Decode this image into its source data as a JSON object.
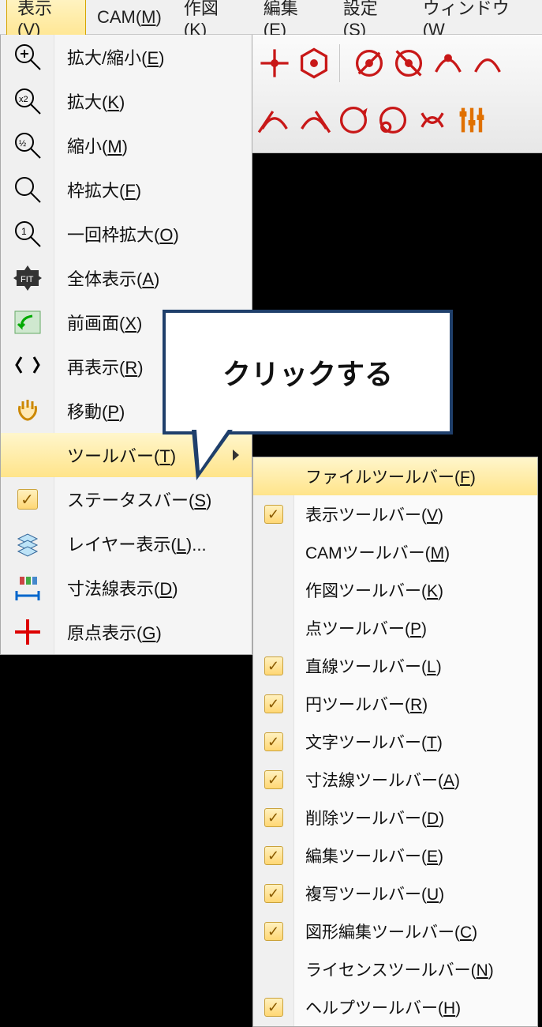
{
  "menubar": {
    "items": [
      {
        "label": "表示(",
        "mn": "V",
        "tail": ")",
        "active": true
      },
      {
        "label": "CAM(",
        "mn": "M",
        "tail": ")"
      },
      {
        "label": "作図(",
        "mn": "K",
        "tail": ")"
      },
      {
        "label": "編集(",
        "mn": "E",
        "tail": ")"
      },
      {
        "label": "設定(",
        "mn": "S",
        "tail": ")"
      },
      {
        "label": "ウィンドウ(",
        "mn": "W",
        "tail": ""
      }
    ]
  },
  "dropdown": {
    "items": [
      {
        "icon": "zoom-plus",
        "label": "拡大/縮小(",
        "mn": "E",
        "tail": ")"
      },
      {
        "icon": "zoom-x2",
        "label": "拡大(",
        "mn": "K",
        "tail": ")"
      },
      {
        "icon": "zoom-half",
        "label": "縮小(",
        "mn": "M",
        "tail": ")"
      },
      {
        "icon": "zoom-frame",
        "label": "枠拡大(",
        "mn": "F",
        "tail": ")"
      },
      {
        "icon": "zoom-once",
        "label": "一回枠拡大(",
        "mn": "O",
        "tail": ")"
      },
      {
        "icon": "fit",
        "label": "全体表示(",
        "mn": "A",
        "tail": ")"
      },
      {
        "icon": "prev",
        "label": "前画面(",
        "mn": "X",
        "tail": ")"
      },
      {
        "icon": "redisplay",
        "label": "再表示(",
        "mn": "R",
        "tail": ")"
      },
      {
        "icon": "pan",
        "label": "移動(",
        "mn": "P",
        "tail": ")"
      },
      {
        "icon": "",
        "label": "ツールバー(",
        "mn": "T",
        "tail": ")",
        "highlight": true,
        "submenu": true
      },
      {
        "icon": "check",
        "label": "ステータスバー(",
        "mn": "S",
        "tail": ")"
      },
      {
        "icon": "layers",
        "label": "レイヤー表示(",
        "mn": "L",
        "tail": ")..."
      },
      {
        "icon": "dim",
        "label": "寸法線表示(",
        "mn": "D",
        "tail": ")"
      },
      {
        "icon": "origin",
        "label": "原点表示(",
        "mn": "G",
        "tail": ")"
      }
    ]
  },
  "submenu": {
    "items": [
      {
        "checked": false,
        "label": "ファイルツールバー(",
        "mn": "F",
        "tail": ")",
        "highlight": true
      },
      {
        "checked": true,
        "label": "表示ツールバー(",
        "mn": "V",
        "tail": ")"
      },
      {
        "checked": false,
        "label": "CAMツールバー(",
        "mn": "M",
        "tail": ")"
      },
      {
        "checked": false,
        "label": "作図ツールバー(",
        "mn": "K",
        "tail": ")"
      },
      {
        "checked": false,
        "label": "点ツールバー(",
        "mn": "P",
        "tail": ")"
      },
      {
        "checked": true,
        "label": "直線ツールバー(",
        "mn": "L",
        "tail": ")"
      },
      {
        "checked": true,
        "label": "円ツールバー(",
        "mn": "R",
        "tail": ")"
      },
      {
        "checked": true,
        "label": "文字ツールバー(",
        "mn": "T",
        "tail": ")"
      },
      {
        "checked": true,
        "label": "寸法線ツールバー(",
        "mn": "A",
        "tail": ")"
      },
      {
        "checked": true,
        "label": "削除ツールバー(",
        "mn": "D",
        "tail": ")"
      },
      {
        "checked": true,
        "label": "編集ツールバー(",
        "mn": "E",
        "tail": ")"
      },
      {
        "checked": true,
        "label": "複写ツールバー(",
        "mn": "U",
        "tail": ")"
      },
      {
        "checked": true,
        "label": "図形編集ツールバー(",
        "mn": "C",
        "tail": ")"
      },
      {
        "checked": false,
        "label": "ライセンスツールバー(",
        "mn": "N",
        "tail": ")"
      },
      {
        "checked": true,
        "label": "ヘルプツールバー(",
        "mn": "H",
        "tail": ")"
      }
    ]
  },
  "callout": {
    "text": "クリックする"
  },
  "toolbar_icons_row1": [
    "cross-target",
    "hex-dot",
    "separator",
    "circle-diag",
    "circle-diag2",
    "arc-dot",
    "arc"
  ],
  "toolbar_icons_row2": [
    "arc-tangent",
    "arc-tangent2",
    "circle-arrow",
    "circle-small",
    "arc-swap",
    "sliders"
  ]
}
